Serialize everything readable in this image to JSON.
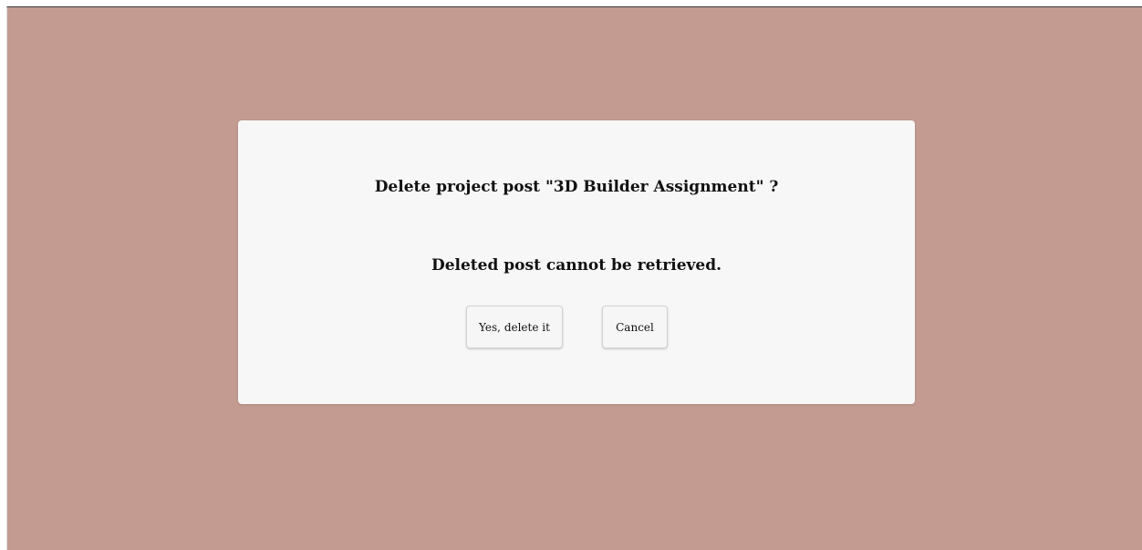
{
  "dialog": {
    "title": "Delete project post \"3D Builder Assignment\" ?",
    "message": "Deleted post cannot be retrieved.",
    "confirm_label": "Yes, delete it",
    "cancel_label": "Cancel"
  },
  "colors": {
    "overlay": "#c39b91",
    "dialog_background": "#f7f7f7",
    "button_background": "#f6f6f6",
    "text": "#111111"
  }
}
